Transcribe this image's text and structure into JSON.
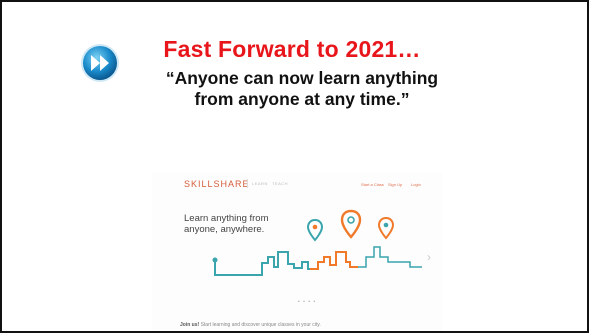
{
  "slide": {
    "title": "Fast Forward to 2021…",
    "quote": "“Anyone can now learn anything from anyone at any time.”",
    "icon": "fast-forward-icon"
  },
  "screenshot": {
    "logo": "SKILLSHARE",
    "nav": [
      "LEARN",
      "TEACH"
    ],
    "right_links": [
      "Start a Class",
      "Sign Up",
      "Login"
    ],
    "hero_line1": "Learn anything from",
    "hero_line2": "anyone, anywhere.",
    "carousel_dots": "• • • •",
    "next_arrow": "›",
    "footer_bold": "Join us!",
    "footer_rest": "Start learning and discover unique classes in your city."
  },
  "colors": {
    "title": "#e8161b",
    "teal": "#3aa5ad",
    "orange": "#f07a2a",
    "brand": "#d55d3d"
  }
}
